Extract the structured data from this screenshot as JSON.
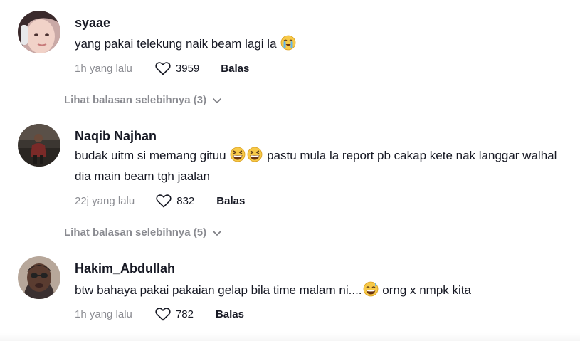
{
  "comments": [
    {
      "username": "syaae",
      "text_before": "yang pakai telekung naik beam lagi la",
      "emoji_1": "loudly-crying-face",
      "time": "1h yang lalu",
      "likes": "3959",
      "reply_label": "Balas",
      "more_replies": "Lihat balasan selebihnya (3)"
    },
    {
      "username": "Naqib Najhan",
      "text_before": "budak uitm si memang gituu",
      "emoji_1": "grinning-squinting-face",
      "emoji_2": "grinning-squinting-face",
      "text_after": "pastu mula la report pb cakap kete nak langgar walhal dia main beam tgh jaalan",
      "time": "22j yang lalu",
      "likes": "832",
      "reply_label": "Balas",
      "more_replies": "Lihat balasan selebihnya (5)"
    },
    {
      "username": "Hakim_Abdullah",
      "text_before": "btw bahaya pakai pakaian gelap bila time malam ni....",
      "emoji_1": "grinning-face-with-sweat",
      "text_after": "orng x nmpk kita",
      "time": "1h yang lalu",
      "likes": "782",
      "reply_label": "Balas"
    }
  ],
  "icons": {
    "like": "heart-outline-icon",
    "expand": "chevron-down-icon"
  },
  "colors": {
    "text": "#161823",
    "muted": "rgba(22,24,35,0.5)",
    "emoji": "#f7c948"
  }
}
